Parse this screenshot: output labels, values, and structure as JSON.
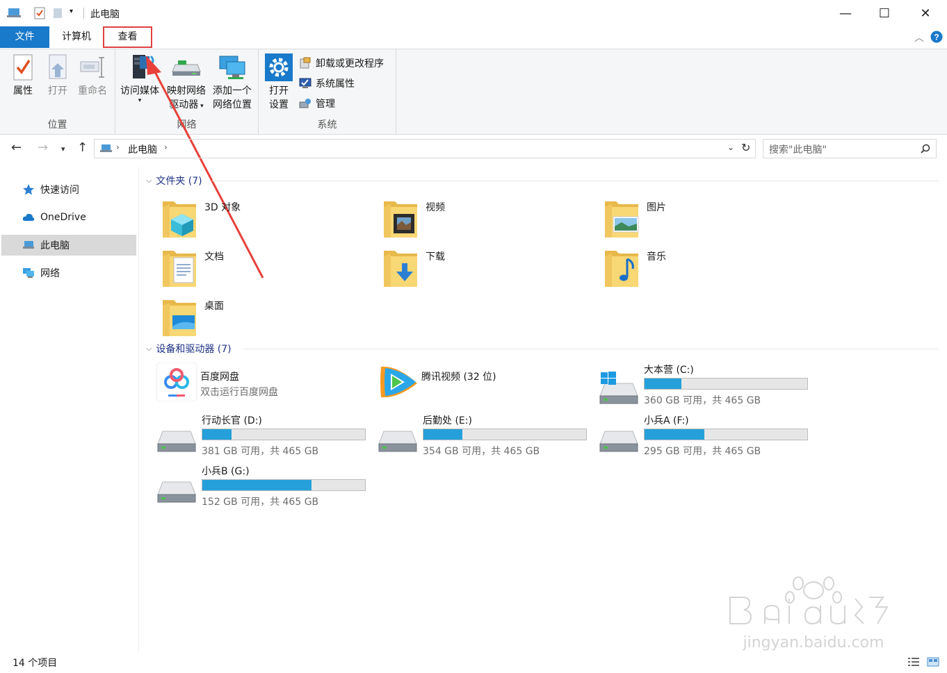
{
  "window": {
    "title": "此电脑"
  },
  "tabs": {
    "file": "文件",
    "computer": "计算机",
    "view": "查看"
  },
  "ribbon": {
    "location": {
      "label": "位置",
      "properties": "属性",
      "open": "打开",
      "rename": "重命名"
    },
    "network": {
      "label": "网络",
      "media": "访问媒体",
      "map_drive_1": "映射网络",
      "map_drive_2": "驱动器",
      "add_loc_1": "添加一个",
      "add_loc_2": "网络位置"
    },
    "system": {
      "label": "系统",
      "open_settings_1": "打开",
      "open_settings_2": "设置",
      "uninstall": "卸载或更改程序",
      "sys_props": "系统属性",
      "manage": "管理"
    }
  },
  "address": {
    "path": "此电脑",
    "search_placeholder": "搜索\"此电脑\""
  },
  "nav": [
    {
      "label": "快速访问"
    },
    {
      "label": "OneDrive"
    },
    {
      "label": "此电脑"
    },
    {
      "label": "网络"
    }
  ],
  "folders_section": "文件夹 (7)",
  "folders": [
    {
      "name": "3D 对象"
    },
    {
      "name": "视频"
    },
    {
      "name": "图片"
    },
    {
      "name": "文档"
    },
    {
      "name": "下载"
    },
    {
      "name": "音乐"
    },
    {
      "name": "桌面"
    }
  ],
  "devices_section": "设备和驱动器 (7)",
  "apps": [
    {
      "name": "百度网盘",
      "sub": "双击运行百度网盘"
    },
    {
      "name": "腾讯视频 (32 位)"
    }
  ],
  "drives": [
    {
      "name": "大本营 (C:)",
      "sub": "360 GB 可用，共 465 GB",
      "used_fraction": 0.226
    },
    {
      "name": "行动长官 (D:)",
      "sub": "381 GB 可用，共 465 GB",
      "used_fraction": 0.181
    },
    {
      "name": "后勤处 (E:)",
      "sub": "354 GB 可用，共 465 GB",
      "used_fraction": 0.239
    },
    {
      "name": "小兵A (F:)",
      "sub": "295 GB 可用，共 465 GB",
      "used_fraction": 0.366
    },
    {
      "name": "小兵B (G:)",
      "sub": "152 GB 可用，共 465 GB",
      "used_fraction": 0.673
    }
  ],
  "status": "14 个项目",
  "colors": {
    "accent": "#1979ca",
    "drive_bar": "#26a0da",
    "highlight_box": "#e04040"
  }
}
